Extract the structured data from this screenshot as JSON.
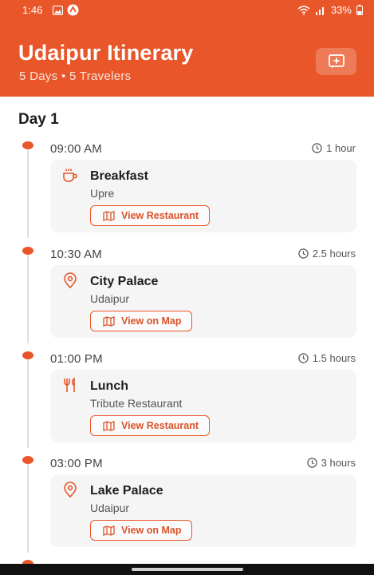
{
  "status": {
    "time": "1:46",
    "battery": "33%"
  },
  "header": {
    "title": "Udaipur Itinerary",
    "subtitle": "5 Days • 5 Travelers"
  },
  "day": {
    "title": "Day 1"
  },
  "items": [
    {
      "time": "09:00 AM",
      "duration": "1 hour",
      "icon": "cup-icon",
      "title": "Breakfast",
      "subtitle": "Upre",
      "button": "View Restaurant"
    },
    {
      "time": "10:30 AM",
      "duration": "2.5 hours",
      "icon": "location-pin-icon",
      "title": "City Palace",
      "subtitle": "Udaipur",
      "button": "View on Map"
    },
    {
      "time": "01:00 PM",
      "duration": "1.5 hours",
      "icon": "fork-knife-icon",
      "title": "Lunch",
      "subtitle": "Tribute Restaurant",
      "button": "View Restaurant"
    },
    {
      "time": "03:00 PM",
      "duration": "3 hours",
      "icon": "location-pin-icon",
      "title": "Lake Palace",
      "subtitle": "Udaipur",
      "button": "View on Map"
    }
  ],
  "colors": {
    "accent": "#e8562a",
    "card_bg": "#f5f5f5"
  }
}
